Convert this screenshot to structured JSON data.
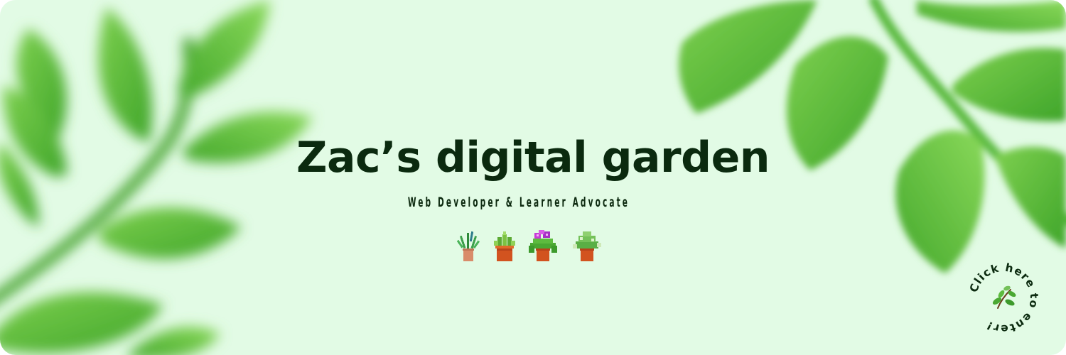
{
  "header": {
    "title": "Zac’s digital garden",
    "subtitle": "Web Developer & Learner Advocate"
  },
  "plants": [
    {
      "icon": "potted-grass-plant-icon"
    },
    {
      "icon": "potted-succulent-icon"
    },
    {
      "icon": "potted-flowering-plant-icon"
    },
    {
      "icon": "potted-fern-icon"
    }
  ],
  "cta": {
    "label": "Click here to enter!",
    "icon": "sprig-icon"
  },
  "colors": {
    "background": "#e2fbe5",
    "text": "#0b2a0f",
    "leaf": "#5cc33a",
    "pot": "#d2531f"
  }
}
